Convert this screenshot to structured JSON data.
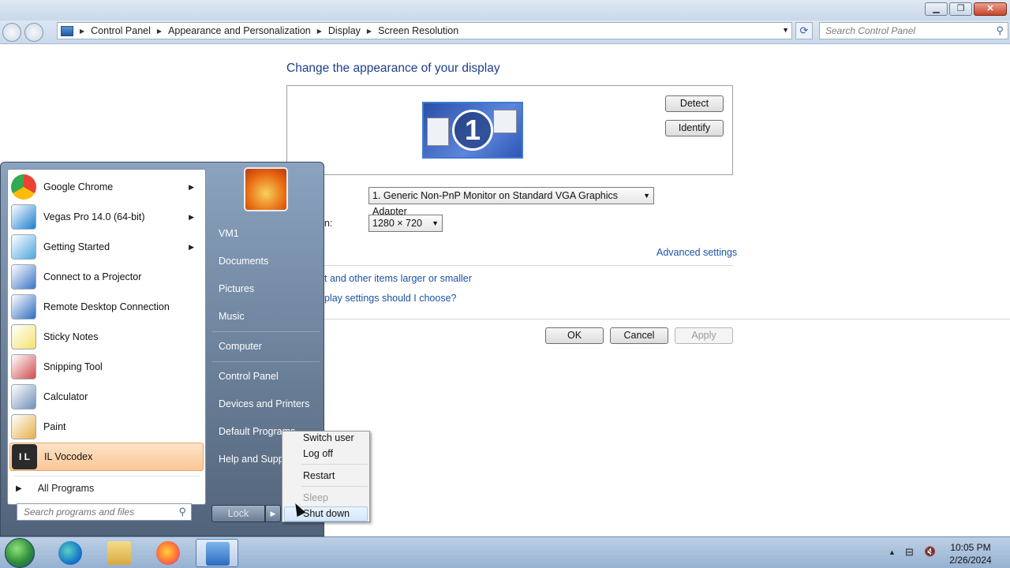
{
  "window": {
    "controls": {
      "minimize": "▁",
      "maximize": "❐",
      "close": "✕"
    }
  },
  "address": {
    "breadcrumbs": [
      "Control Panel",
      "Appearance and Personalization",
      "Display",
      "Screen Resolution"
    ],
    "separator": "▶",
    "dropdown_arrow": "▼",
    "refresh_icon": "⟳",
    "search_placeholder": "Search Control Panel",
    "search_icon": "⚲"
  },
  "display": {
    "heading": "Change the appearance of your display",
    "monitor_number": "1",
    "detect_label": "Detect",
    "identify_label": "Identify",
    "display_value": "1. Generic Non-PnP Monitor on Standard VGA Graphics Adapter",
    "resolution_label_partial": "n:",
    "resolution_value": "1280 × 720",
    "advanced_link": "Advanced settings",
    "link_text_size": "t and other items larger or smaller",
    "link_which_settings": "play settings should I choose?",
    "ok_label": "OK",
    "cancel_label": "Cancel",
    "apply_label": "Apply",
    "combo_arrow": "▼"
  },
  "start_menu": {
    "programs": [
      {
        "label": "Google Chrome",
        "icon": "chrome-icon",
        "color": "#e84335",
        "has_submenu": true
      },
      {
        "label": "Vegas Pro 14.0 (64-bit)",
        "icon": "vegas-icon",
        "color": "#1b7fd0",
        "has_submenu": true
      },
      {
        "label": "Getting Started",
        "icon": "getting-started-icon",
        "color": "#4ea6de",
        "has_submenu": true
      },
      {
        "label": "Connect to a Projector",
        "icon": "projector-icon",
        "color": "#3a74c4",
        "has_submenu": false
      },
      {
        "label": "Remote Desktop Connection",
        "icon": "remote-desktop-icon",
        "color": "#2d6cc0",
        "has_submenu": false
      },
      {
        "label": "Sticky Notes",
        "icon": "sticky-notes-icon",
        "color": "#f4e36a",
        "has_submenu": false
      },
      {
        "label": "Snipping Tool",
        "icon": "snipping-tool-icon",
        "color": "#d34c4c",
        "has_submenu": false
      },
      {
        "label": "Calculator",
        "icon": "calculator-icon",
        "color": "#6f8fb8",
        "has_submenu": false
      },
      {
        "label": "Paint",
        "icon": "paint-icon",
        "color": "#e6b04a",
        "has_submenu": false
      },
      {
        "label": "IL Vocodex",
        "icon": "vocodex-icon",
        "color": "#2b2b2b",
        "has_submenu": false,
        "highlighted": true
      }
    ],
    "submenu_arrow": "▶",
    "all_programs_label": "All Programs",
    "all_programs_arrow": "▶",
    "search_placeholder": "Search programs and files",
    "search_icon": "⚲",
    "right_items": [
      "VM1",
      "Documents",
      "Pictures",
      "Music",
      "Computer",
      "Control Panel",
      "Devices and Printers",
      "Default Programs",
      "Help and Support"
    ],
    "lock_label": "Lock",
    "lock_arrow": "▶",
    "icon_letters": "I L"
  },
  "power_menu": {
    "items": [
      {
        "label": "Switch user",
        "enabled": true
      },
      {
        "label": "Log off",
        "enabled": true
      },
      {
        "label": "Restart",
        "enabled": true
      },
      {
        "label": "Sleep",
        "enabled": false
      },
      {
        "label": "Shut down",
        "enabled": true,
        "hovered": true
      }
    ]
  },
  "taskbar": {
    "tray_expand": "▲",
    "tray_network": "⊟",
    "tray_volume": "🔇",
    "clock_time": "10:05 PM",
    "clock_date": "2/26/2024"
  }
}
